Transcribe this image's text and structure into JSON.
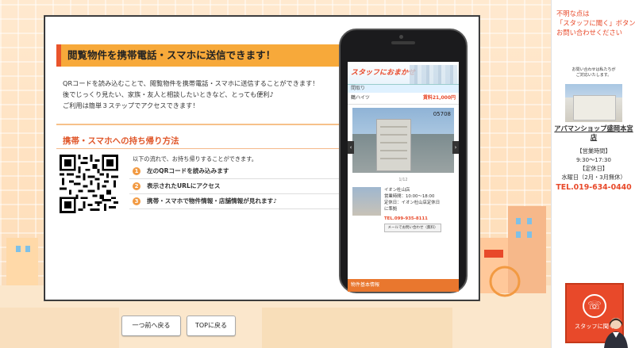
{
  "modal": {
    "title": "閲覧物件を携帯電話・スマホに送信できます！",
    "intro": [
      "QRコードを読み込むことで、閲覧物件を携帯電話・スマホに送信することができます！",
      "後でじっくり見たい、家族・友人と相談したいときなど、とっても便利♪",
      "ご利用は簡単３ステップでアクセスできます！"
    ],
    "sub_title": "携帯・スマホへの持ち帰り方法",
    "steps_intro": "以下の流れで、お持ち帰りすることができます。",
    "steps": [
      {
        "num": "1",
        "label": "左のQRコードを読み込みます"
      },
      {
        "num": "2",
        "label": "表示されたURLにアクセス"
      },
      {
        "num": "3",
        "label": "携帯・スマホで物件情報・店舗情報が見れます♪"
      }
    ]
  },
  "phone_screen": {
    "logo": "スタッフにおまかせ",
    "breadcrumb": "間取り",
    "property_name": "鶴ハイツ",
    "rent": "賃料21,000円",
    "photo_code": "05708",
    "prev_arrow": "‹",
    "next_arrow": "›",
    "photo_count": "1/12",
    "shop_lines": [
      "イオン杜山店",
      "営業時間：10:00〜18:00",
      "定休日：イオン杜山店定休日",
      "に準拠"
    ],
    "shop_tel": "TEL.099-935-8111",
    "mail_button": "メールでお問い合わせ（無料）",
    "footer": "物件基本情報"
  },
  "nav": {
    "back_label": "一つ前へ戻る",
    "top_label": "TOPに戻る"
  },
  "side": {
    "notice": [
      "不明な点は",
      "「スタッフに聞く」ボタンで",
      "お問い合わせください"
    ],
    "photo_caption": [
      "お問い合わせは私たちが",
      "ご対応いたします。"
    ],
    "shop_name": "アパマンショップ盛岡本宮店",
    "hours_title": "【営業時間】",
    "hours": "9:30〜17:30",
    "holiday_title": "【定休日】",
    "holiday": "水曜日（2月・3月無休）",
    "tel": "TEL.019-634-0440",
    "call_label": "スタッフに聞く"
  },
  "colors": {
    "accent": "#e8492a",
    "title_bar": "#f7a93a",
    "step_num": "#f29a42"
  }
}
